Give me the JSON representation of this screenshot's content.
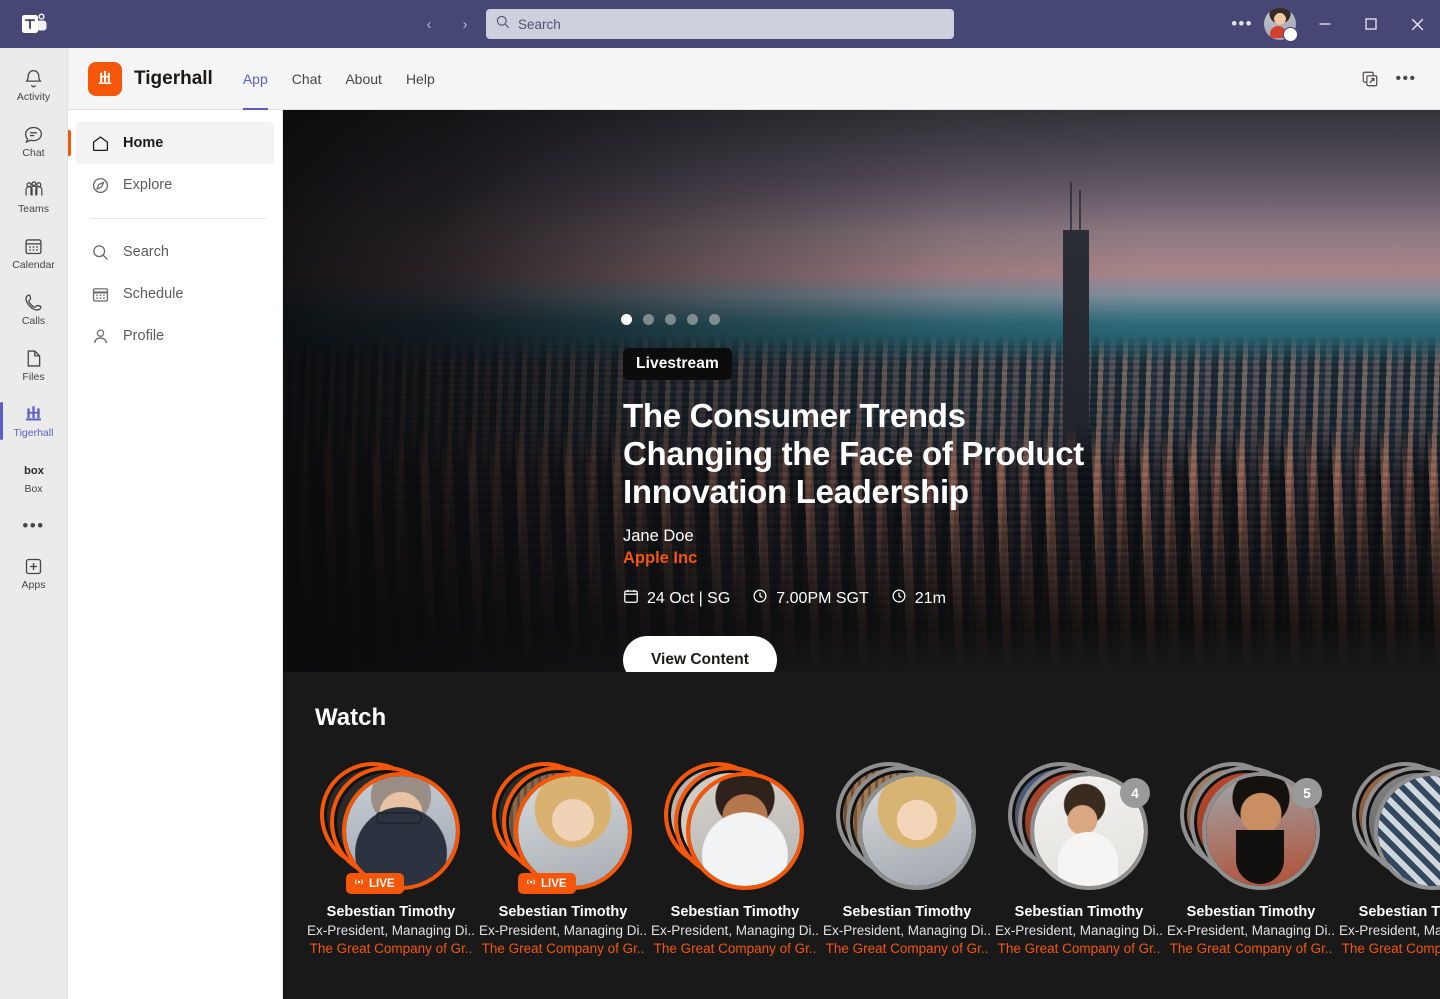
{
  "titlebar": {
    "app_icon": "teams-logo-icon",
    "back_label": "‹",
    "forward_label": "›",
    "search_placeholder": "Search",
    "more_label": "•••",
    "minimize_label": "─",
    "maximize_label": "☐",
    "close_label": "✕"
  },
  "rail": {
    "items": [
      {
        "label": "Activity",
        "icon": "bell-icon",
        "active": false
      },
      {
        "label": "Chat",
        "icon": "chat-icon",
        "active": false
      },
      {
        "label": "Teams",
        "icon": "teams-people-icon",
        "active": false
      },
      {
        "label": "Calendar",
        "icon": "calendar-icon",
        "active": false
      },
      {
        "label": "Calls",
        "icon": "phone-icon",
        "active": false
      },
      {
        "label": "Files",
        "icon": "file-icon",
        "active": false
      },
      {
        "label": "Tigerhall",
        "icon": "tigerhall-icon",
        "active": true
      },
      {
        "label": "Box",
        "icon": "box-icon",
        "active": false
      },
      {
        "label": "Apps",
        "icon": "plus-square-icon",
        "active": false
      }
    ],
    "overflow_label": "•••"
  },
  "app_header": {
    "logo_icon": "tigerhall-logo-icon",
    "name": "Tigerhall",
    "tabs": [
      {
        "label": "App",
        "active": true
      },
      {
        "label": "Chat",
        "active": false
      },
      {
        "label": "About",
        "active": false
      },
      {
        "label": "Help",
        "active": false
      }
    ],
    "popout_icon": "open-in-new-window-icon",
    "more_label": "•••"
  },
  "leftnav": {
    "items": [
      {
        "label": "Home",
        "icon": "home-icon",
        "active": true
      },
      {
        "label": "Explore",
        "icon": "compass-icon",
        "active": false
      },
      {
        "label": "Search",
        "icon": "search-icon",
        "active": false
      },
      {
        "label": "Schedule",
        "icon": "calendar-icon",
        "active": false
      },
      {
        "label": "Profile",
        "icon": "person-icon",
        "active": false
      }
    ]
  },
  "hero": {
    "carousel": {
      "total": 5,
      "active_index": 0
    },
    "badge": "Livestream",
    "title": "The Consumer Trends Changing the Face of Product Innovation Leadership",
    "author": "Jane Doe",
    "company": "Apple Inc",
    "meta": [
      {
        "icon": "calendar-icon",
        "text": "24 Oct | SG"
      },
      {
        "icon": "clock-icon",
        "text": "7.00PM SGT"
      },
      {
        "icon": "clock-icon",
        "text": "21m"
      }
    ],
    "cta_label": "View Content"
  },
  "watch": {
    "title": "Watch",
    "cards": [
      {
        "name": "Sebestian Timothy",
        "role": "Ex-President, Managing Di..",
        "org": "The Great Company of Gr..",
        "live": true,
        "ring": "orange",
        "count": null,
        "face": "face-1"
      },
      {
        "name": "Sebestian Timothy",
        "role": "Ex-President, Managing Di..",
        "org": "The Great Company of Gr..",
        "live": true,
        "ring": "orange",
        "count": null,
        "face": "face-2"
      },
      {
        "name": "Sebestian Timothy",
        "role": "Ex-President, Managing Di..",
        "org": "The Great Company of Gr..",
        "live": false,
        "ring": "orange",
        "count": null,
        "face": "face-3"
      },
      {
        "name": "Sebestian Timothy",
        "role": "Ex-President, Managing Di..",
        "org": "The Great Company of Gr..",
        "live": false,
        "ring": "grey",
        "count": null,
        "face": "face-4"
      },
      {
        "name": "Sebestian Timothy",
        "role": "Ex-President, Managing Di..",
        "org": "The Great Company of Gr..",
        "live": false,
        "ring": "grey",
        "count": "4",
        "face": "face-5"
      },
      {
        "name": "Sebestian Timothy",
        "role": "Ex-President, Managing Di..",
        "org": "The Great Company of Gr..",
        "live": false,
        "ring": "grey",
        "count": "5",
        "face": "face-6"
      },
      {
        "name": "Sebestian Timothy",
        "role": "Ex-President, Managing Di..",
        "org": "The Great Company of Gr..",
        "live": false,
        "ring": "grey",
        "count": null,
        "face": "face-7"
      }
    ],
    "live_label": "LIVE"
  },
  "colors": {
    "teams_purple": "#464775",
    "accent_orange": "#f45709",
    "content_bg": "#191919",
    "teams_accent": "#5b5fc7"
  }
}
